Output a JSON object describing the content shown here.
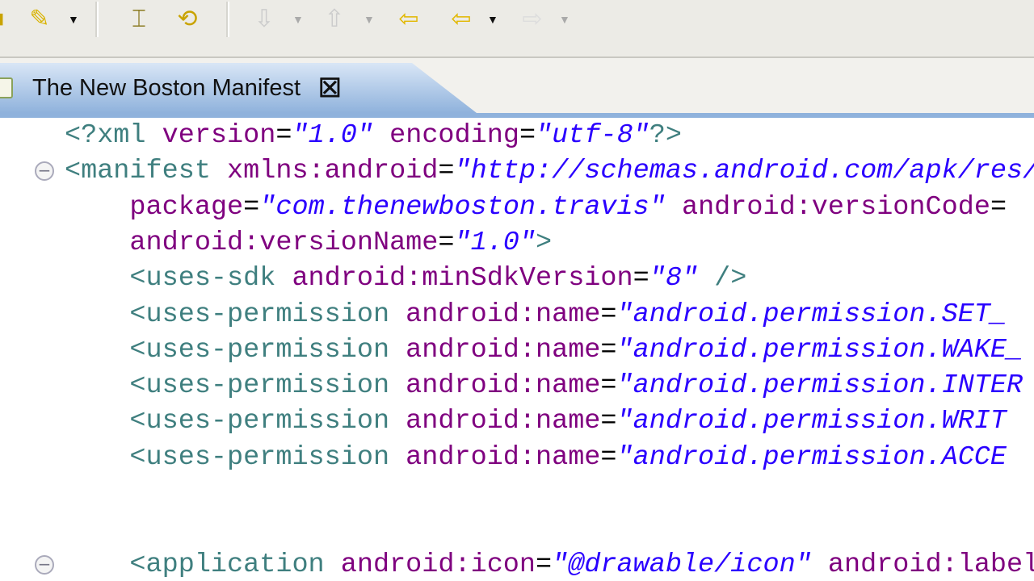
{
  "toolbar": {
    "icons": [
      "pin-icon",
      "open-type-icon",
      "refresh-icon",
      "next-annotation-icon",
      "previous-annotation-icon",
      "last-edit-location-icon",
      "back-icon",
      "forward-icon"
    ]
  },
  "tab": {
    "title": "The New Boston Manifest",
    "close": "☒"
  },
  "editor": {
    "lines": [
      [
        {
          "t": "tag",
          "v": "<?xml "
        },
        {
          "t": "attr",
          "v": "version"
        },
        {
          "t": "eq",
          "v": "="
        },
        {
          "t": "val",
          "v": "\"1.0\""
        },
        {
          "t": "eq",
          "v": " "
        },
        {
          "t": "attr",
          "v": "encoding"
        },
        {
          "t": "eq",
          "v": "="
        },
        {
          "t": "val",
          "v": "\"utf-8\""
        },
        {
          "t": "tag",
          "v": "?>"
        }
      ],
      [
        {
          "t": "tag",
          "v": "<manifest "
        },
        {
          "t": "attr",
          "v": "xmlns:android"
        },
        {
          "t": "eq",
          "v": "="
        },
        {
          "t": "val",
          "v": "\"http://schemas.android.com/apk/res/android\""
        }
      ],
      [
        {
          "t": "eq",
          "v": "    "
        },
        {
          "t": "attr",
          "v": "package"
        },
        {
          "t": "eq",
          "v": "="
        },
        {
          "t": "val",
          "v": "\"com.thenewboston.travis\""
        },
        {
          "t": "eq",
          "v": " "
        },
        {
          "t": "attr",
          "v": "android:versionCode"
        },
        {
          "t": "eq",
          "v": "="
        }
      ],
      [
        {
          "t": "eq",
          "v": "    "
        },
        {
          "t": "attr",
          "v": "android:versionName"
        },
        {
          "t": "eq",
          "v": "="
        },
        {
          "t": "val",
          "v": "\"1.0\""
        },
        {
          "t": "tag",
          "v": ">"
        }
      ],
      [
        {
          "t": "tag",
          "v": "    <uses-sdk "
        },
        {
          "t": "attr",
          "v": "android:minSdkVersion"
        },
        {
          "t": "eq",
          "v": "="
        },
        {
          "t": "val",
          "v": "\"8\""
        },
        {
          "t": "tag",
          "v": " />"
        }
      ],
      [
        {
          "t": "tag",
          "v": "    <uses-permission "
        },
        {
          "t": "attr",
          "v": "android:name"
        },
        {
          "t": "eq",
          "v": "="
        },
        {
          "t": "val",
          "v": "\"android.permission.SET_"
        }
      ],
      [
        {
          "t": "tag",
          "v": "    <uses-permission "
        },
        {
          "t": "attr",
          "v": "android:name"
        },
        {
          "t": "eq",
          "v": "="
        },
        {
          "t": "val",
          "v": "\"android.permission.WAKE_"
        }
      ],
      [
        {
          "t": "tag",
          "v": "    <uses-permission "
        },
        {
          "t": "attr",
          "v": "android:name"
        },
        {
          "t": "eq",
          "v": "="
        },
        {
          "t": "val",
          "v": "\"android.permission.INTER"
        }
      ],
      [
        {
          "t": "tag",
          "v": "    <uses-permission "
        },
        {
          "t": "attr",
          "v": "android:name"
        },
        {
          "t": "eq",
          "v": "="
        },
        {
          "t": "val",
          "v": "\"android.permission.WRIT"
        }
      ],
      [
        {
          "t": "tag",
          "v": "    <uses-permission "
        },
        {
          "t": "attr",
          "v": "android:name"
        },
        {
          "t": "eq",
          "v": "="
        },
        {
          "t": "val",
          "v": "\"android.permission.ACCE"
        }
      ],
      [],
      [],
      [
        {
          "t": "tag",
          "v": "    <application "
        },
        {
          "t": "attr",
          "v": "android:icon"
        },
        {
          "t": "eq",
          "v": "="
        },
        {
          "t": "val",
          "v": "\"@drawable/icon\""
        },
        {
          "t": "eq",
          "v": " "
        },
        {
          "t": "attr",
          "v": "android:label"
        }
      ]
    ],
    "fold_lines": [
      1,
      12
    ],
    "fold_symbol": "⊟"
  }
}
